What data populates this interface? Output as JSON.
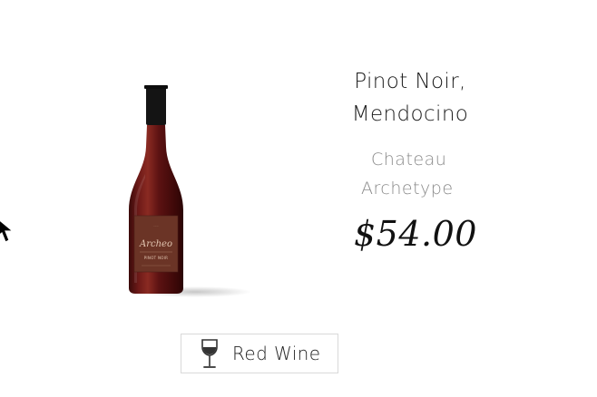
{
  "product": {
    "name_line1": "Pinot Noir,",
    "name_line2": "Mendocino",
    "producer_line1": "Chateau",
    "producer_line2": "Archetype",
    "price": "$54.00",
    "label_brand": "Archeo",
    "label_varietal": "PINOT NOIR",
    "wine_type": "Red Wine"
  },
  "icons": {
    "wine_type": "wine-glass-icon",
    "cursor": "mouse-pointer-icon"
  },
  "colors": {
    "wine": "#5a1414",
    "label": "#6b3426",
    "capsule": "#141414",
    "badge_border": "#d9d9d9",
    "producer_text": "#8a8a8a"
  }
}
